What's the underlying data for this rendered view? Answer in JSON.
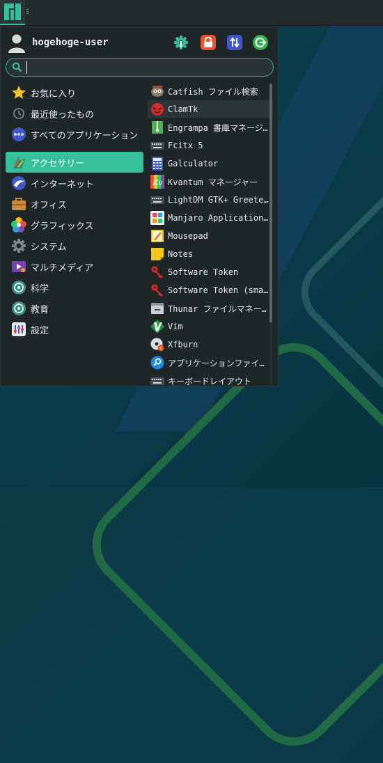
{
  "panel": {
    "logo_icon": "manjaro-logo-icon",
    "accent": "#35bf9a"
  },
  "user": {
    "name": "hogehoge-user"
  },
  "actions": [
    {
      "name": "settings-manager-icon",
      "color": "#35bf9a"
    },
    {
      "name": "lock-screen-icon",
      "color": "#e8552a"
    },
    {
      "name": "switch-user-icon",
      "color": "#3f58c9"
    },
    {
      "name": "log-out-icon",
      "color": "#32b34d"
    }
  ],
  "search": {
    "value": "",
    "placeholder": ""
  },
  "categories": [
    {
      "label": "お気に入り",
      "icon": "star-icon"
    },
    {
      "label": "最近使ったもの",
      "icon": "clock-icon"
    },
    {
      "label": "すべてのアプリケーション",
      "icon": "dots-icon"
    },
    {
      "label": "アクセサリー",
      "icon": "accessories-icon",
      "selected": true
    },
    {
      "label": "インターネット",
      "icon": "globe-icon"
    },
    {
      "label": "オフィス",
      "icon": "briefcase-icon"
    },
    {
      "label": "グラフィックス",
      "icon": "graphics-icon"
    },
    {
      "label": "システム",
      "icon": "gear-icon"
    },
    {
      "label": "マルチメディア",
      "icon": "multimedia-icon"
    },
    {
      "label": "科学",
      "icon": "science-icon"
    },
    {
      "label": "教育",
      "icon": "education-icon"
    },
    {
      "label": "設定",
      "icon": "settings-icon"
    }
  ],
  "apps": [
    {
      "label": "Catfish ファイル検索",
      "icon": "catfish-icon"
    },
    {
      "label": "ClamTk",
      "icon": "clamtk-icon",
      "highlighted": true
    },
    {
      "label": "Engrampa 書庫マネージャー",
      "icon": "archive-icon"
    },
    {
      "label": "Fcitx 5",
      "icon": "keyboard-icon"
    },
    {
      "label": "Galculator",
      "icon": "calculator-icon"
    },
    {
      "label": "Kvantum マネージャー",
      "icon": "kvantum-icon"
    },
    {
      "label": "LightDM GTK+ Greeter settings",
      "icon": "keyboard-icon"
    },
    {
      "label": "Manjaro Application Utility",
      "icon": "app-utility-icon"
    },
    {
      "label": "Mousepad",
      "icon": "text-editor-icon"
    },
    {
      "label": "Notes",
      "icon": "notes-icon"
    },
    {
      "label": "Software Token",
      "icon": "token-icon"
    },
    {
      "label": "Software Token (smartphone)",
      "icon": "token-icon"
    },
    {
      "label": "Thunar ファイルマネージャー",
      "icon": "folder-icon"
    },
    {
      "label": "Vim",
      "icon": "vim-icon"
    },
    {
      "label": "Xfburn",
      "icon": "disc-burner-icon"
    },
    {
      "label": "アプリケーションファインダー",
      "icon": "app-finder-icon"
    },
    {
      "label": "キーボードレイアウト",
      "icon": "keyboard-icon"
    }
  ]
}
